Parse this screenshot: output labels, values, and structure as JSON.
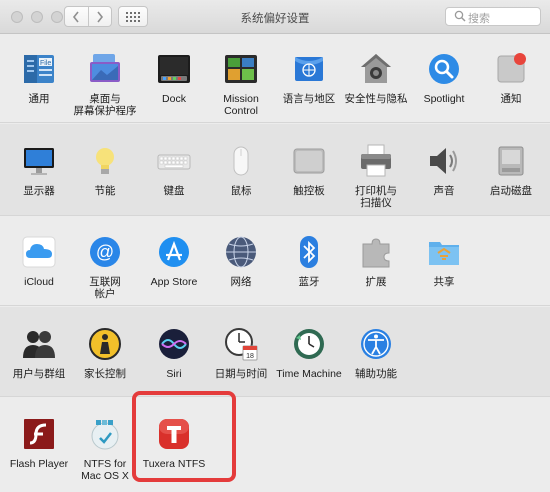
{
  "window": {
    "title": "系统偏好设置"
  },
  "search": {
    "placeholder": "搜索"
  },
  "row1": [
    "通用",
    "桌面与\n屏幕保护程序",
    "Dock",
    "Mission\nControl",
    "语言与地区",
    "安全性与隐私",
    "Spotlight",
    "通知"
  ],
  "row2": [
    "显示器",
    "节能",
    "键盘",
    "鼠标",
    "触控板",
    "打印机与\n扫描仪",
    "声音",
    "启动磁盘"
  ],
  "row3": [
    "iCloud",
    "互联网\n帐户",
    "App Store",
    "网络",
    "蓝牙",
    "扩展",
    "共享"
  ],
  "row4": [
    "用户与群组",
    "家长控制",
    "Siri",
    "日期与时间",
    "Time Machine",
    "辅助功能"
  ],
  "row5": [
    "Flash Player",
    "NTFS for\nMac OS X",
    "Tuxera NTFS"
  ],
  "calendar_day": "18",
  "colors": {
    "highlight": "#e43b3b",
    "accent_blue": "#1e7ce6",
    "tuxera_red": "#d9302b"
  }
}
